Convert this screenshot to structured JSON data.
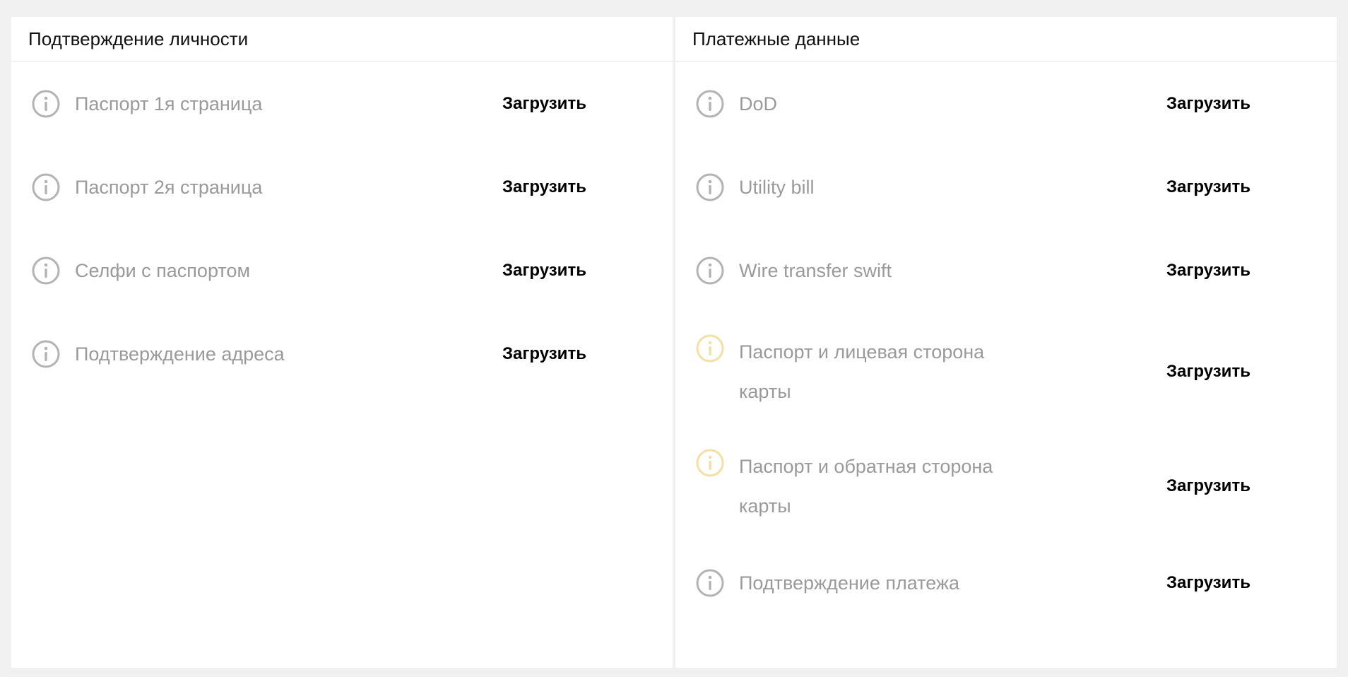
{
  "colors": {
    "icon_default": "#b3b3b3",
    "icon_warning": "#f5dfa3",
    "label": "#9a9a9a",
    "header_text": "#111111",
    "background": "#f0f0f0",
    "panel": "#ffffff"
  },
  "identity": {
    "title": "Подтверждение личности",
    "items": [
      {
        "label": "Паспорт 1я страница",
        "action": "Загрузить",
        "icon": "info-icon",
        "status": "default"
      },
      {
        "label": "Паспорт 2я страница",
        "action": "Загрузить",
        "icon": "info-icon",
        "status": "default"
      },
      {
        "label": "Селфи с паспортом",
        "action": "Загрузить",
        "icon": "info-icon",
        "status": "default"
      },
      {
        "label": "Подтверждение адреса",
        "action": "Загрузить",
        "icon": "info-icon",
        "status": "default"
      }
    ]
  },
  "payment": {
    "title": "Платежные данные",
    "items": [
      {
        "label": "DoD",
        "action": "Загрузить",
        "icon": "info-icon",
        "status": "default"
      },
      {
        "label": "Utility bill",
        "action": "Загрузить",
        "icon": "info-icon",
        "status": "default"
      },
      {
        "label": "Wire transfer swift",
        "action": "Загрузить",
        "icon": "info-icon",
        "status": "default"
      },
      {
        "label": "Паспорт и лицевая сторона карты",
        "action": "Загрузить",
        "icon": "info-icon",
        "status": "warning"
      },
      {
        "label": "Паспорт и обратная сторона карты",
        "action": "Загрузить",
        "icon": "info-icon",
        "status": "warning"
      },
      {
        "label": "Подтверждение платежа",
        "action": "Загрузить",
        "icon": "info-icon",
        "status": "default"
      }
    ]
  }
}
